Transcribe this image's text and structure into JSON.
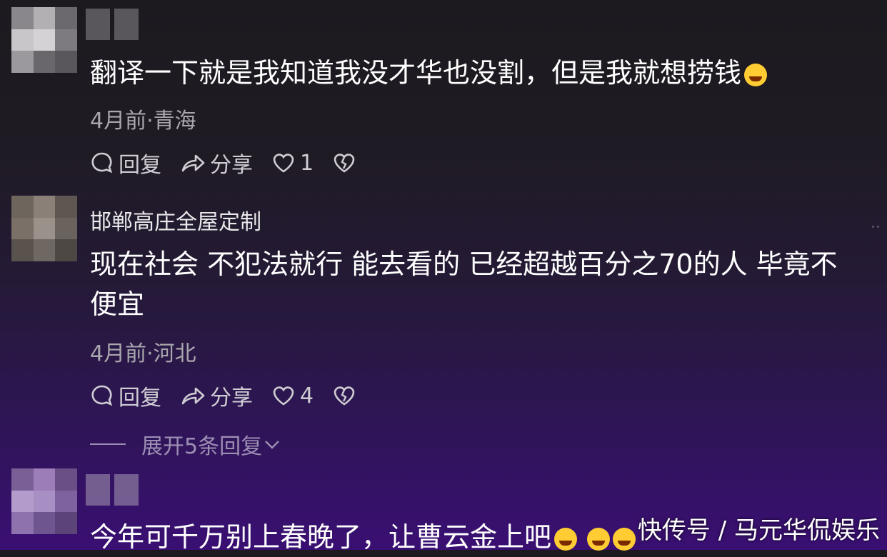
{
  "comments": [
    {
      "username": "",
      "text": "翻译一下就是我知道我没才华也没割，但是我就想捞钱",
      "time_location": "4月前·青海",
      "reply_label": "回复",
      "share_label": "分享",
      "like_count": "1"
    },
    {
      "username": "邯郸高庄全屋定制",
      "text_line1": "现在社会  不犯法就行  能去看的 已经超越百分之70的人  毕竟不",
      "text_line2": "便宜",
      "time_location": "4月前·河北",
      "reply_label": "回复",
      "share_label": "分享",
      "like_count": "4",
      "expand_label": "展开5条回复"
    },
    {
      "username": "",
      "text": "今年可千万别上春晚了，让曹云金上吧"
    }
  ],
  "watermark": "快传号 / 马元华侃娱乐",
  "more_dots": "··",
  "colors": {
    "accent_bottom": "#3a0f73",
    "background_top": "#1c1a1f"
  }
}
